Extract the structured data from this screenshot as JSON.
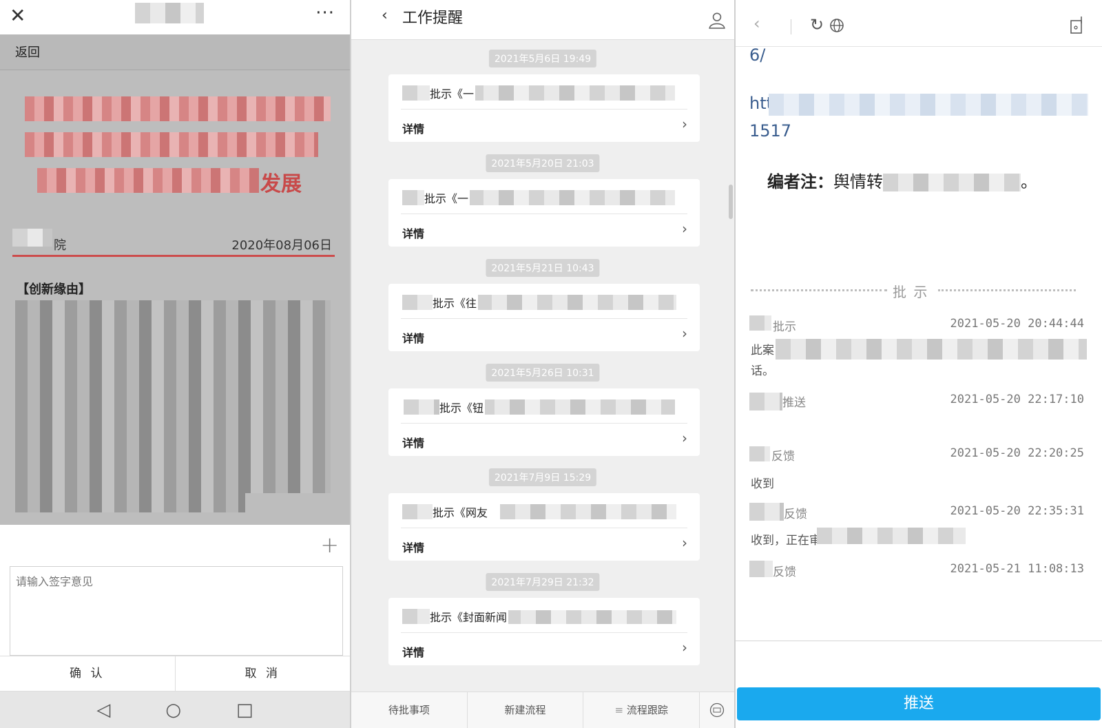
{
  "panel1": {
    "back_label": "返回",
    "title_tail": "发展",
    "org_suffix": "院",
    "date": "2020年08月06日",
    "section_heading": "【创新缘由】",
    "comment_placeholder": "请输入签字意见",
    "confirm_label": "确 认",
    "cancel_label": "取 消"
  },
  "panel2": {
    "title": "工作提醒",
    "items": [
      {
        "time": "2021年5月6日  19:49",
        "title_text": "批示《一",
        "detail": "详情"
      },
      {
        "time": "2021年5月20日  21:03",
        "title_text": "批示《一",
        "detail": "详情"
      },
      {
        "time": "2021年5月21日  10:43",
        "title_text": "批示《往",
        "detail": "详情"
      },
      {
        "time": "2021年5月26日  10:31",
        "title_text": "批示《钮",
        "detail": "详情"
      },
      {
        "time": "2021年7月9日  15:29",
        "title_text": "批示《网友",
        "detail": "详情"
      },
      {
        "time": "2021年7月29日  21:32",
        "title_text": "批示《封面新闻",
        "detail": "详情"
      }
    ],
    "tabs": [
      "待批事项",
      "新建流程",
      "流程跟踪"
    ]
  },
  "panel3": {
    "link_line1": "6/",
    "link_line2": "htt",
    "link_line3": "1517",
    "note_label": "编者注：",
    "note_text": "舆情转",
    "note_tail": "。",
    "divider_label": "批 示",
    "log": [
      {
        "label": "批示",
        "time": "2021-05-20 20:44:44",
        "body": "此案",
        "body2": "话。"
      },
      {
        "label": "推送",
        "time": "2021-05-20 22:17:10",
        "body": "",
        "body2": ""
      },
      {
        "label": "反馈",
        "time": "2021-05-20 22:20:25",
        "body": "收到",
        "body2": ""
      },
      {
        "label": "反馈",
        "time": "2021-05-20 22:35:31",
        "body": "收到，正在审",
        "body2": ""
      },
      {
        "label": "反馈",
        "time": "2021-05-21 11:08:13",
        "body": "",
        "body2": ""
      }
    ],
    "push_label": "推送"
  }
}
